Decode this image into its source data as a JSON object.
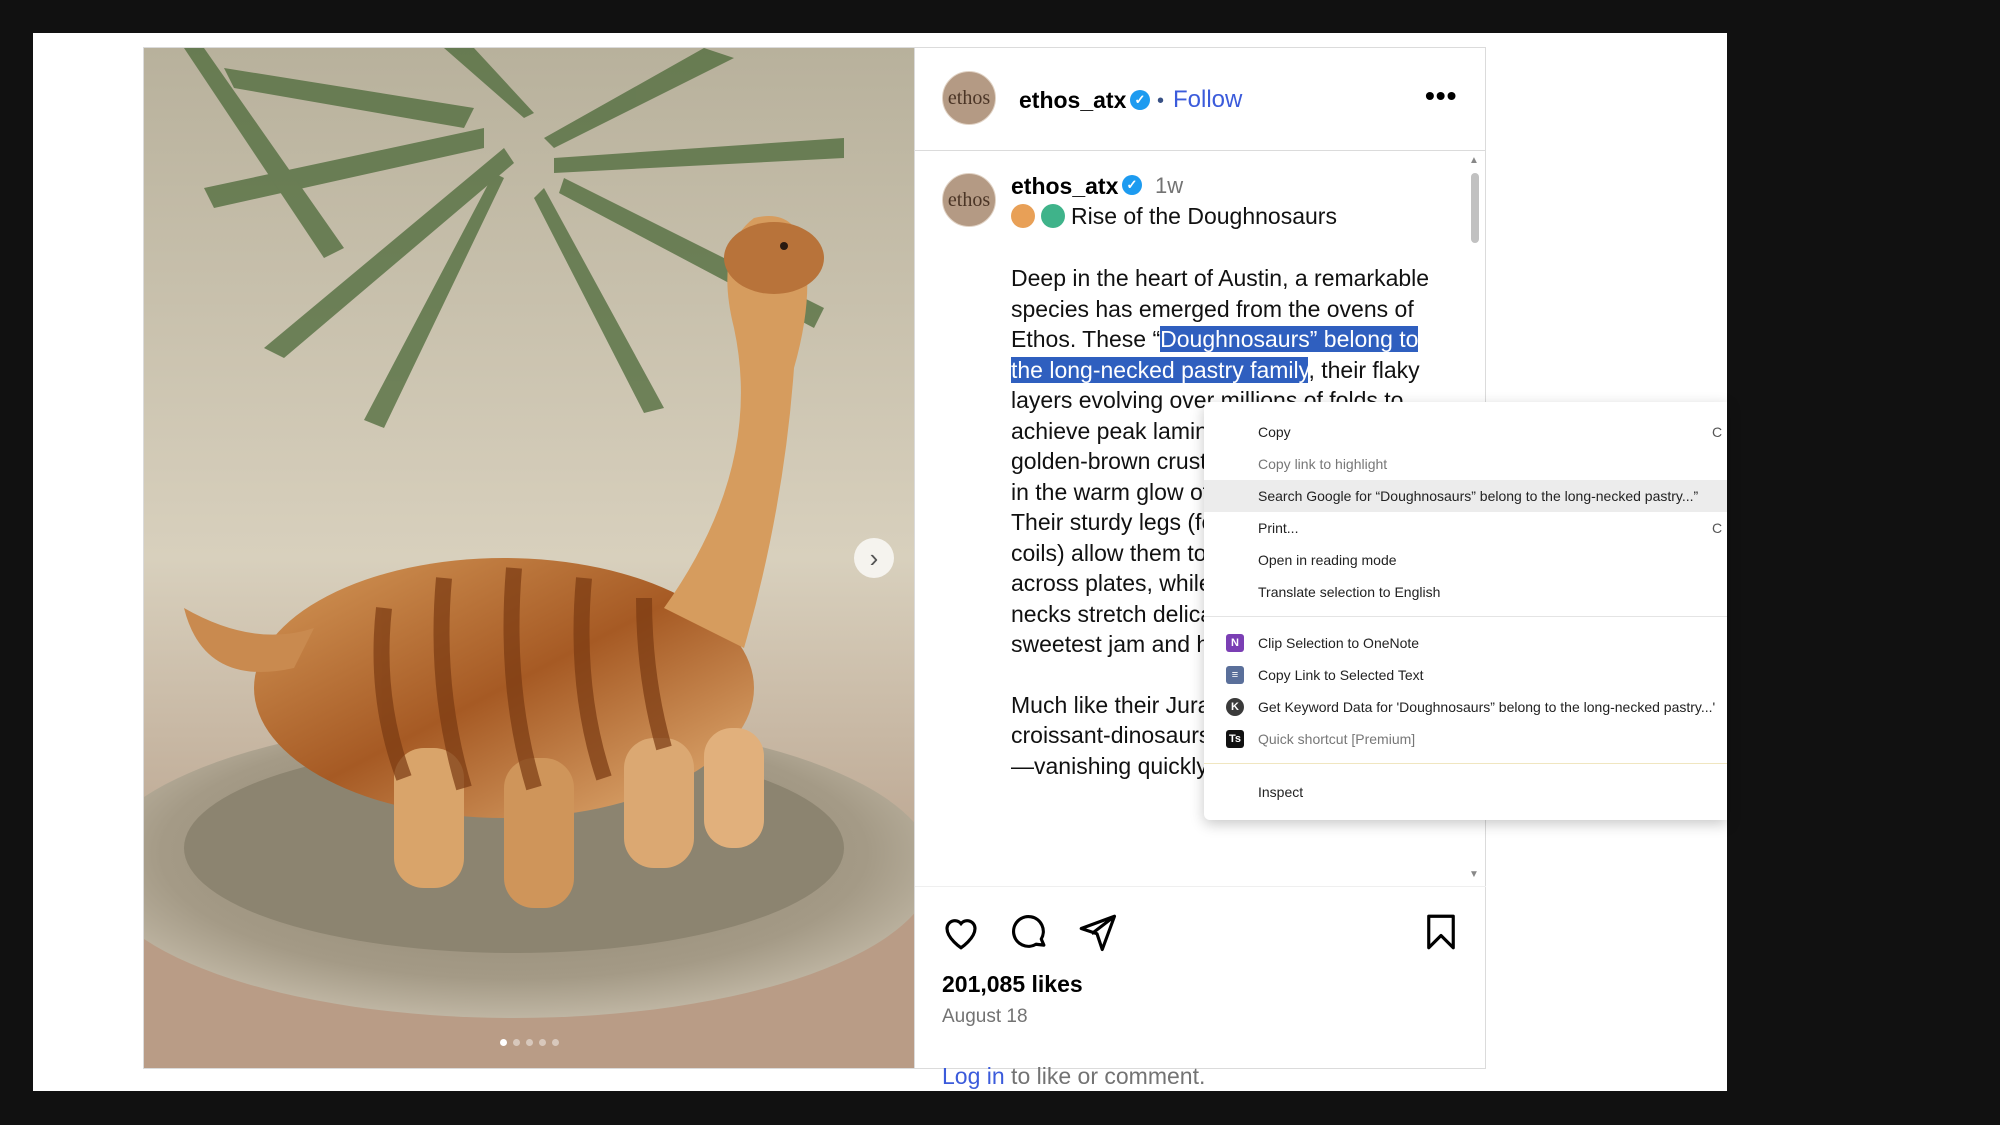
{
  "post": {
    "username": "ethos_atx",
    "avatar_text": "ethos",
    "follow_label": "Follow",
    "separator": "•",
    "more_icon": "more-horizontal-icon",
    "time_ago": "1w",
    "caption_title": "Rise of the Doughnosaurs",
    "caption_pre_highlight": "Deep in the heart of Austin, a remarkable species has emerged from the ovens of Ethos. These “",
    "caption_highlight": "Doughnosaurs” belong to the long-necked pastry family",
    "caption_post_highlight": ", their flaky layers evolving over millions of folds to achieve peak lamination. Note the golden-brown crust—perfect for basking in the warm glow of morning coffee. Their sturdy legs (formed of dense butter coils) allow them to migrate gracefully across plates, while their elongated necks stretch delicately toward the sweetest jam and honey.",
    "caption_para2": "Much like their Jurassic ancestors, these croissant-dinosaurs are rare and fleeting—vanishing quickly once",
    "likes": "201,085 likes",
    "date": "August 18",
    "login_link": "Log in",
    "login_rest": " to like or comment.",
    "image_alt": "Croissant shaped like a long-necked dinosaur on a plate",
    "carousel_count": 5,
    "carousel_active": 1
  },
  "context_menu": {
    "items": [
      {
        "label": "Copy",
        "shortcut": "C"
      },
      {
        "label": "Copy link to highlight"
      },
      {
        "label": "Search Google for “Doughnosaurs” belong to the long-necked pastry...”"
      },
      {
        "label": "Print...",
        "shortcut": "C"
      },
      {
        "label": "Open in reading mode"
      },
      {
        "label": "Translate selection to English"
      },
      {
        "label": "Clip Selection to OneNote",
        "icon": "onenote-icon"
      },
      {
        "label": "Copy Link to Selected Text",
        "icon": "link-text-icon"
      },
      {
        "label": "Get Keyword Data for 'Doughnosaurs” belong to the long-necked pastry...'",
        "icon": "keyword-icon"
      },
      {
        "label": "Quick shortcut [Premium]",
        "icon": "ts-icon"
      },
      {
        "label": "Inspect"
      }
    ]
  },
  "colors": {
    "accent": "#3b5bdb",
    "highlight": "#2f5fbf",
    "verified": "#1d9bf0",
    "background": "#111111"
  }
}
